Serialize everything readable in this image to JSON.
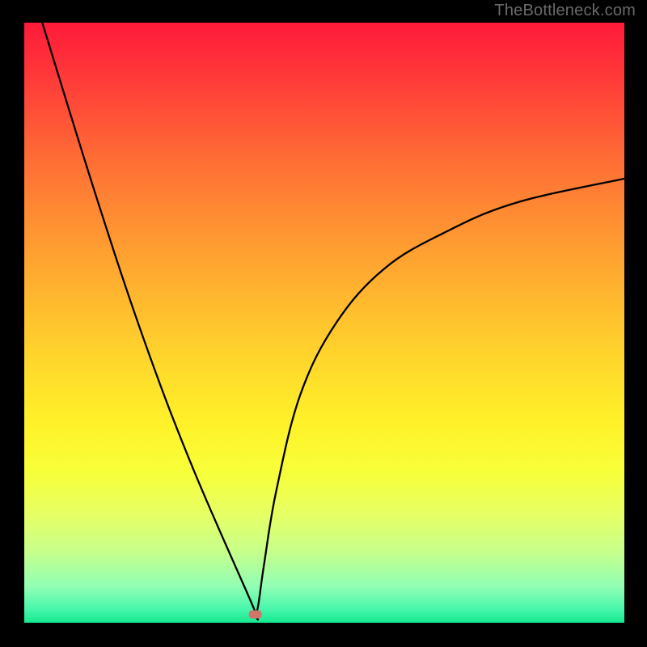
{
  "watermark": {
    "text": "TheBottleneck.com"
  },
  "chart_data": {
    "type": "line",
    "title": "",
    "xlabel": "",
    "ylabel": "",
    "xlim": [
      0,
      100
    ],
    "ylim": [
      0,
      100
    ],
    "grid": false,
    "legend": false,
    "background": "vertical-gradient red(top) to green(bottom) via yellow",
    "series": [
      {
        "name": "curve",
        "x": [
          3,
          12,
          20,
          28,
          38,
          38.5,
          39,
          40,
          42,
          46,
          52,
          60,
          70,
          82,
          100
        ],
        "y": [
          100,
          71,
          47,
          26,
          3,
          1.4,
          3,
          10,
          22,
          38,
          50,
          59,
          65,
          70,
          74
        ],
        "note": "V-shaped curve with minimum near x≈38; left branch steeper than right"
      }
    ],
    "marker": {
      "x": 38.5,
      "y": 1.4,
      "shape": "rounded-rect",
      "color": "#d0776c"
    }
  },
  "colors": {
    "frame": "#000000",
    "curve": "#000000",
    "marker": "#d0776c"
  }
}
